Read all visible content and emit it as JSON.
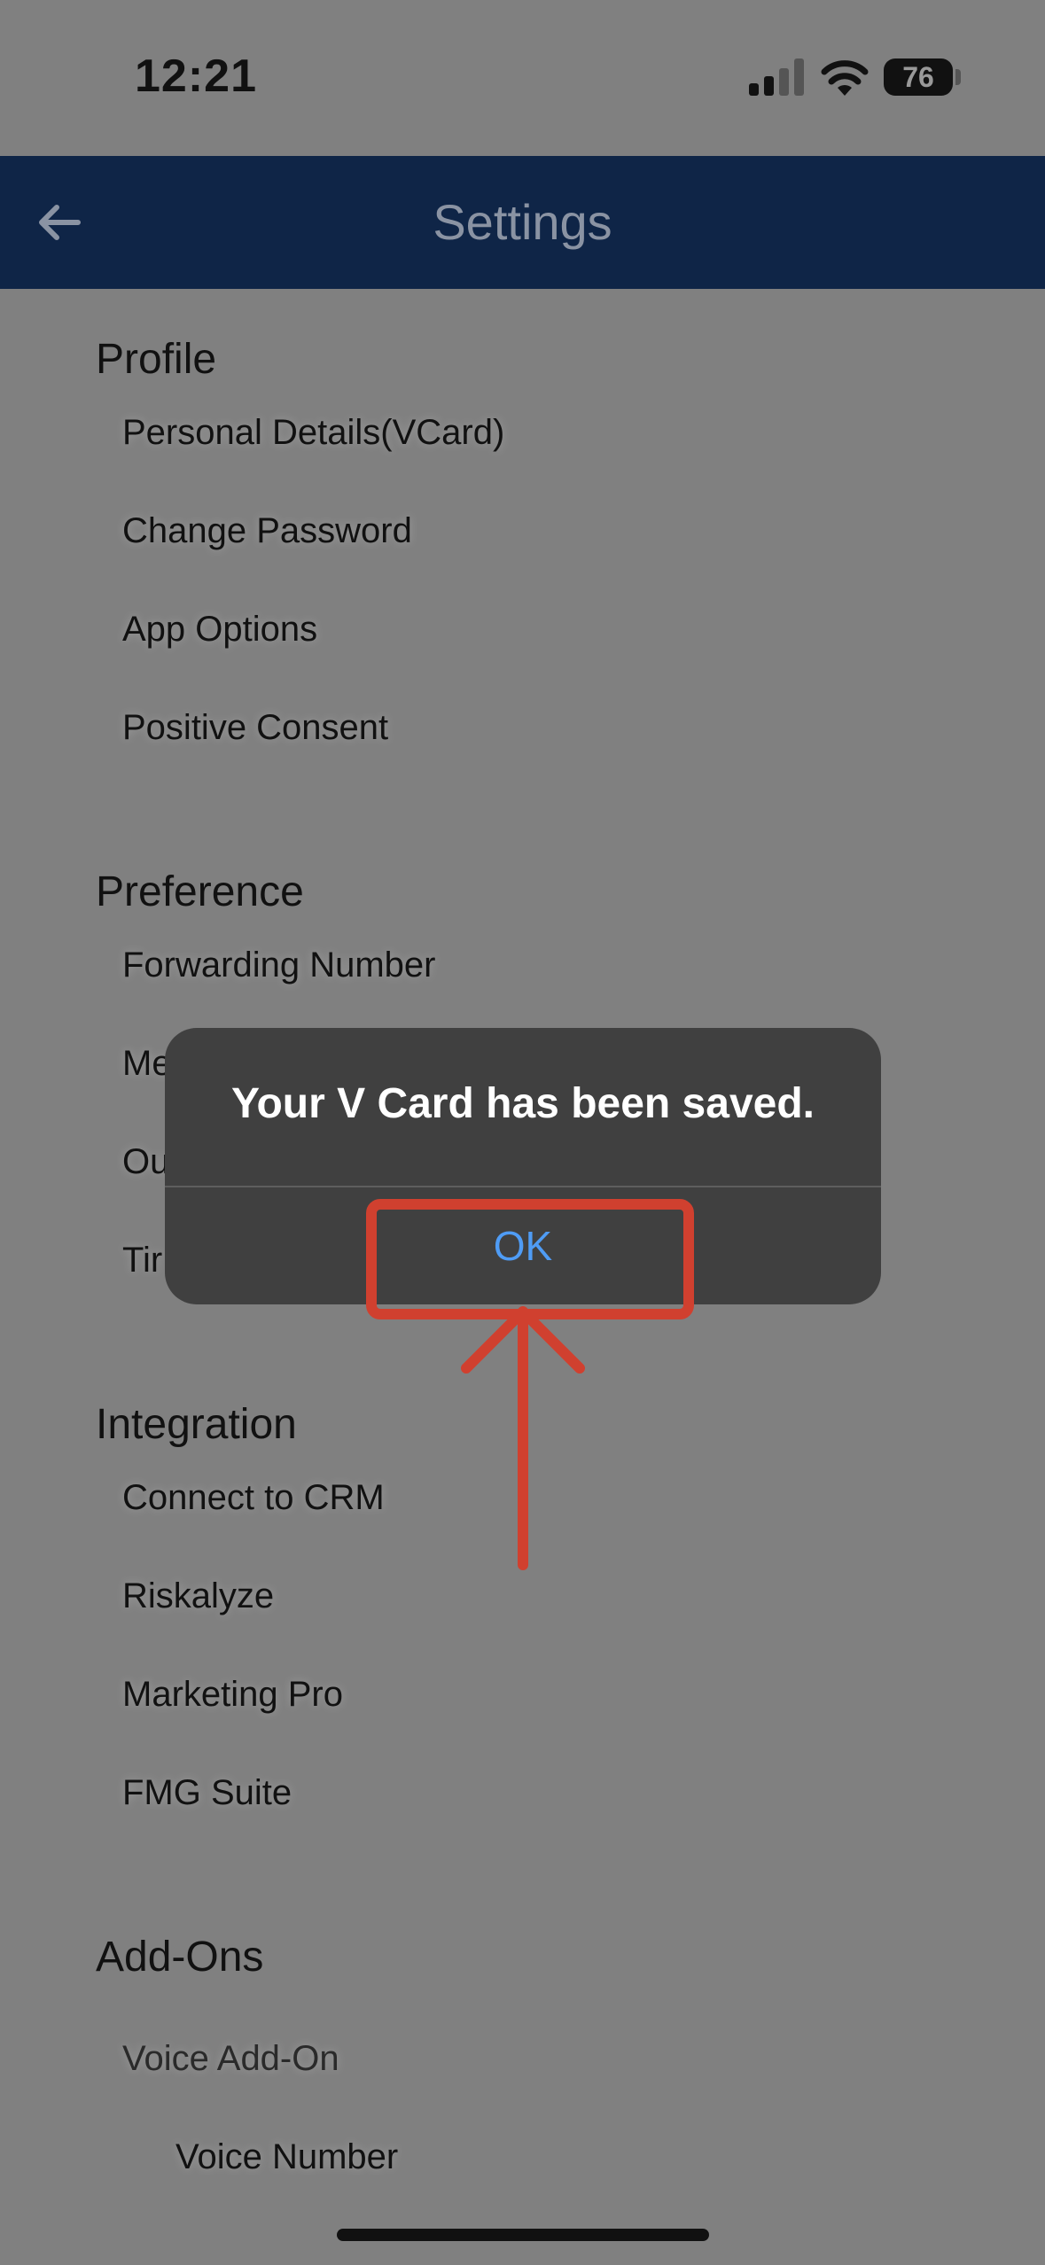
{
  "status_bar": {
    "time": "12:21",
    "battery_level": "76"
  },
  "header": {
    "title": "Settings"
  },
  "sections": [
    {
      "title": "Profile",
      "items": [
        "Personal Details(VCard)",
        "Change Password",
        "App Options",
        "Positive Consent"
      ]
    },
    {
      "title": "Preference",
      "items": [
        "Forwarding Number",
        "Me",
        "Ou",
        "Tir"
      ]
    },
    {
      "title": "Integration",
      "items": [
        "Connect to CRM",
        "Riskalyze",
        "Marketing Pro",
        "FMG Suite"
      ]
    },
    {
      "title": "Add-Ons",
      "items": [
        "Voice Add-On",
        "Voice Number"
      ]
    }
  ],
  "dialog": {
    "message": "Your V Card has been saved.",
    "ok_label": "OK"
  },
  "colors": {
    "nav_bg": "#0f2547",
    "overlay": "#808080",
    "dialog_bg": "#404040",
    "ok_text": "#4f9cf5",
    "annotation": "#d0402f"
  }
}
